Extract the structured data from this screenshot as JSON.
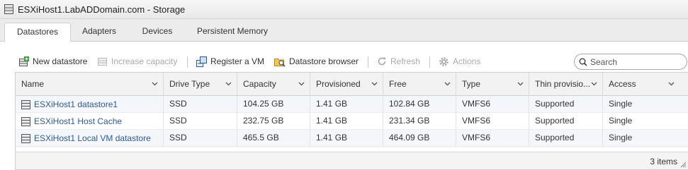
{
  "window": {
    "title": "ESXiHost1.LabADDomain.com - Storage"
  },
  "tabs": [
    {
      "label": "Datastores",
      "active": true
    },
    {
      "label": "Adapters",
      "active": false
    },
    {
      "label": "Devices",
      "active": false
    },
    {
      "label": "Persistent Memory",
      "active": false
    }
  ],
  "toolbar": {
    "new_datastore": "New datastore",
    "increase_capacity": "Increase capacity",
    "register_vm": "Register a VM",
    "datastore_browser": "Datastore browser",
    "refresh": "Refresh",
    "actions": "Actions"
  },
  "search": {
    "placeholder": "Search",
    "value": ""
  },
  "table": {
    "columns": [
      "Name",
      "Drive Type",
      "Capacity",
      "Provisioned",
      "Free",
      "Type",
      "Thin provisio...",
      "Access"
    ],
    "rows": [
      {
        "name": "ESXiHost1 datastore1",
        "drive_type": "SSD",
        "capacity": "104.25 GB",
        "provisioned": "1.41 GB",
        "free": "102.84 GB",
        "type": "VMFS6",
        "thin": "Supported",
        "access": "Single"
      },
      {
        "name": "ESXiHost1 Host Cache",
        "drive_type": "SSD",
        "capacity": "232.75 GB",
        "provisioned": "1.41 GB",
        "free": "231.34 GB",
        "type": "VMFS6",
        "thin": "Supported",
        "access": "Single"
      },
      {
        "name": "ESXiHost1 Local VM datastore",
        "drive_type": "SSD",
        "capacity": "465.5 GB",
        "provisioned": "1.41 GB",
        "free": "464.09 GB",
        "type": "VMFS6",
        "thin": "Supported",
        "access": "Single"
      }
    ],
    "item_count": "3 items"
  },
  "colors": {
    "link": "#2c5a9c",
    "disabled": "#a9a9a9",
    "row_alt": "#f3f6fa",
    "header_bg": "#f2f2f2"
  }
}
